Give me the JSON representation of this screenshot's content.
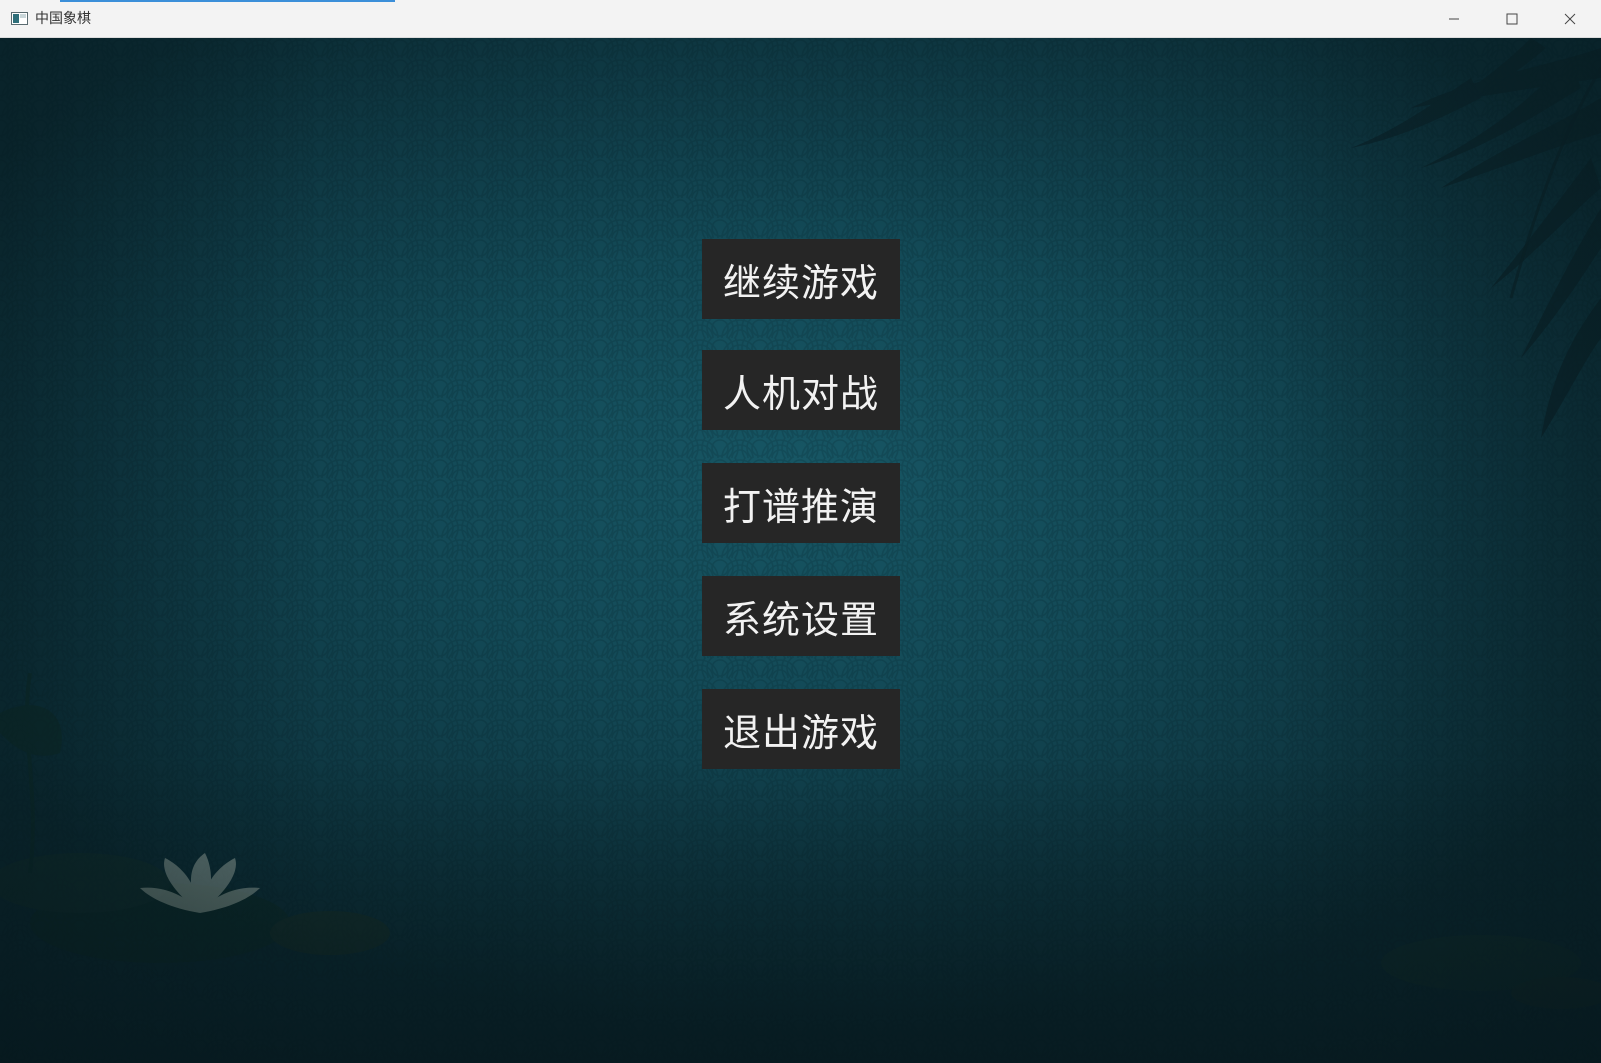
{
  "window": {
    "title": "中国象棋",
    "controls": [
      "minimize",
      "maximize",
      "close"
    ]
  },
  "menu": {
    "items": [
      {
        "label": "继续游戏"
      },
      {
        "label": "人机对战"
      },
      {
        "label": "打谱推演"
      },
      {
        "label": "系统设置"
      },
      {
        "label": "退出游戏"
      }
    ]
  },
  "theme": {
    "background": "#134a57",
    "button_bg": "#262626",
    "button_text": "#f2f2f2"
  }
}
